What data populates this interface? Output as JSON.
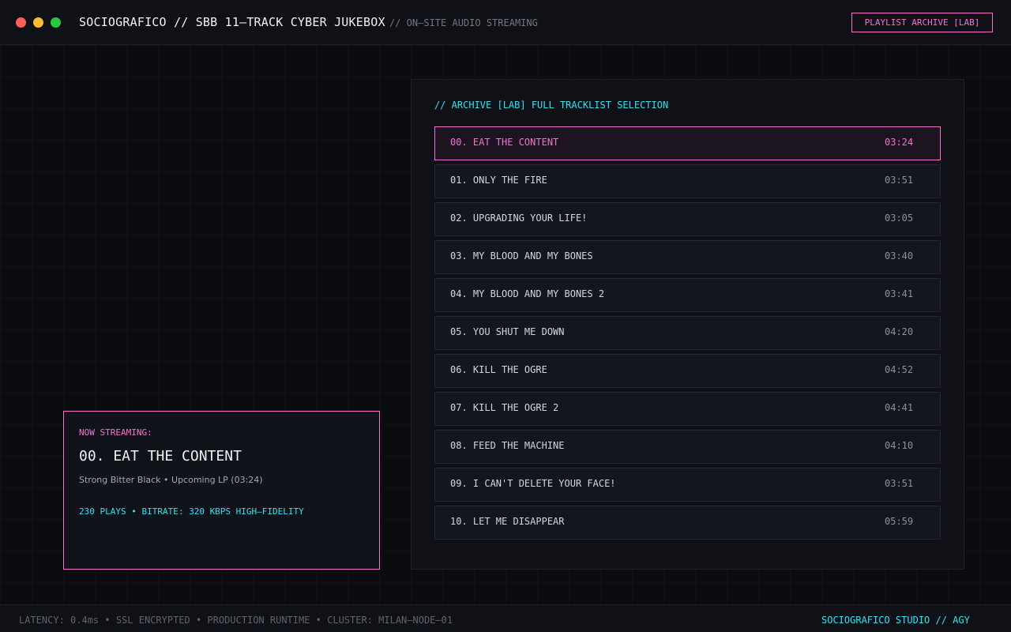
{
  "colors": {
    "accent_pink": "#f472d0",
    "accent_cyan": "#36e0f0",
    "background": "#0b0c10",
    "panel": "#0f1117"
  },
  "window": {
    "controls": [
      "close-dot",
      "minimize-dot",
      "maximize-dot"
    ]
  },
  "header": {
    "title": "SOCIOGRAFICO // SBB 11–TRACK CYBER JUKEBOX",
    "subtitle": "// ON–SITE AUDIO STREAMING",
    "archive_button": "PLAYLIST ARCHIVE [LAB]"
  },
  "tracklist": {
    "heading": "// ARCHIVE [LAB] FULL TRACKLIST SELECTION",
    "active_index": 0,
    "tracks": [
      {
        "title": "00. EAT THE CONTENT",
        "duration": "03:24"
      },
      {
        "title": "01. ONLY THE FIRE",
        "duration": "03:51"
      },
      {
        "title": "02. UPGRADING YOUR LIFE!",
        "duration": "03:05"
      },
      {
        "title": "03. MY BLOOD AND MY BONES",
        "duration": "03:40"
      },
      {
        "title": "04. MY BLOOD AND MY BONES 2",
        "duration": "03:41"
      },
      {
        "title": "05. YOU SHUT ME DOWN",
        "duration": "04:20"
      },
      {
        "title": "06. KILL THE OGRE",
        "duration": "04:52"
      },
      {
        "title": "07. KILL THE OGRE 2",
        "duration": "04:41"
      },
      {
        "title": "08. FEED THE MACHINE",
        "duration": "04:10"
      },
      {
        "title": "09. I CAN'T DELETE YOUR FACE!",
        "duration": "03:51"
      },
      {
        "title": "10. LET ME DISAPPEAR",
        "duration": "05:59"
      }
    ]
  },
  "now_streaming": {
    "label": "NOW STREAMING:",
    "title": "00. EAT THE CONTENT",
    "meta": "Strong Bitter Black • Upcoming LP (03:24)",
    "stats": "230 PLAYS • BITRATE: 320 KBPS HIGH–FIDELITY"
  },
  "footer": {
    "status": "LATENCY: 0.4ms • SSL ENCRYPTED • PRODUCTION RUNTIME • CLUSTER: MILAN–NODE–01",
    "brand": "SOCIOGRAFICO STUDIO // AGY"
  }
}
